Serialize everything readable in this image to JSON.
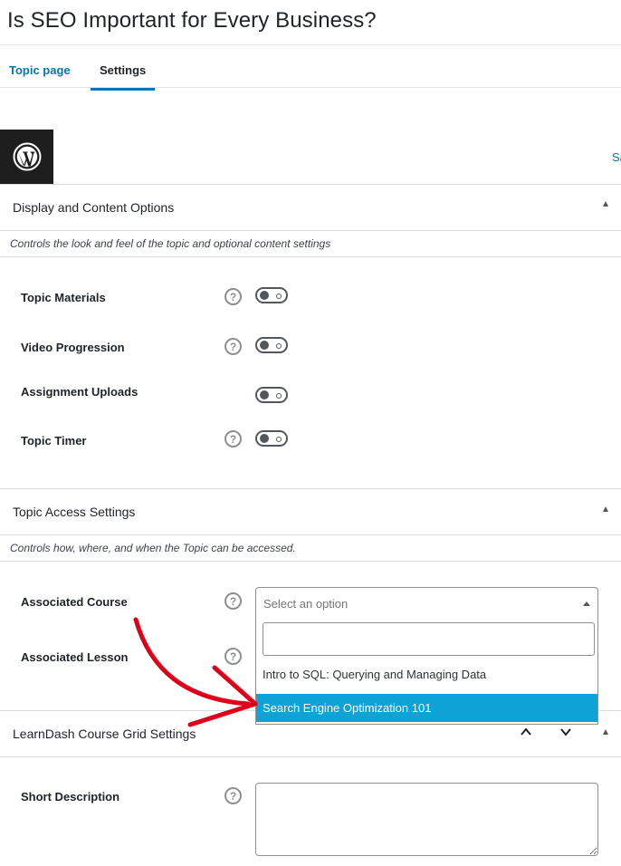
{
  "title": "Is SEO Important for Every Business?",
  "tabs": [
    {
      "label": "Topic page",
      "active": false
    },
    {
      "label": "Settings",
      "active": true
    }
  ],
  "toolbar": {
    "save_partial": "Sa"
  },
  "display_section": {
    "title": "Display and Content Options",
    "description": "Controls the look and feel of the topic and optional content settings",
    "rows": [
      {
        "label": "Topic Materials",
        "has_help": true,
        "enabled": false
      },
      {
        "label": "Video Progression",
        "has_help": true,
        "enabled": false
      },
      {
        "label": "Assignment Uploads",
        "has_help": false,
        "enabled": false
      },
      {
        "label": "Topic Timer",
        "has_help": true,
        "enabled": false
      }
    ]
  },
  "access_section": {
    "title": "Topic Access Settings",
    "description": "Controls how, where, and when the Topic can be accessed.",
    "associated_course": {
      "label": "Associated Course",
      "placeholder": "Select an option",
      "search_value": "",
      "options": [
        {
          "label": "Intro to SQL: Querying and Managing Data",
          "highlighted": false
        },
        {
          "label": "Search Engine Optimization 101",
          "highlighted": true
        }
      ]
    },
    "associated_lesson": {
      "label": "Associated Lesson"
    }
  },
  "grid_section": {
    "title": "LearnDash Course Grid Settings",
    "short_description": {
      "label": "Short Description",
      "value": ""
    }
  },
  "help_glyph": "?",
  "colors": {
    "accent": "#0675b1",
    "highlight": "#0ea2d6",
    "annotation_arrow": "#e1001a"
  }
}
